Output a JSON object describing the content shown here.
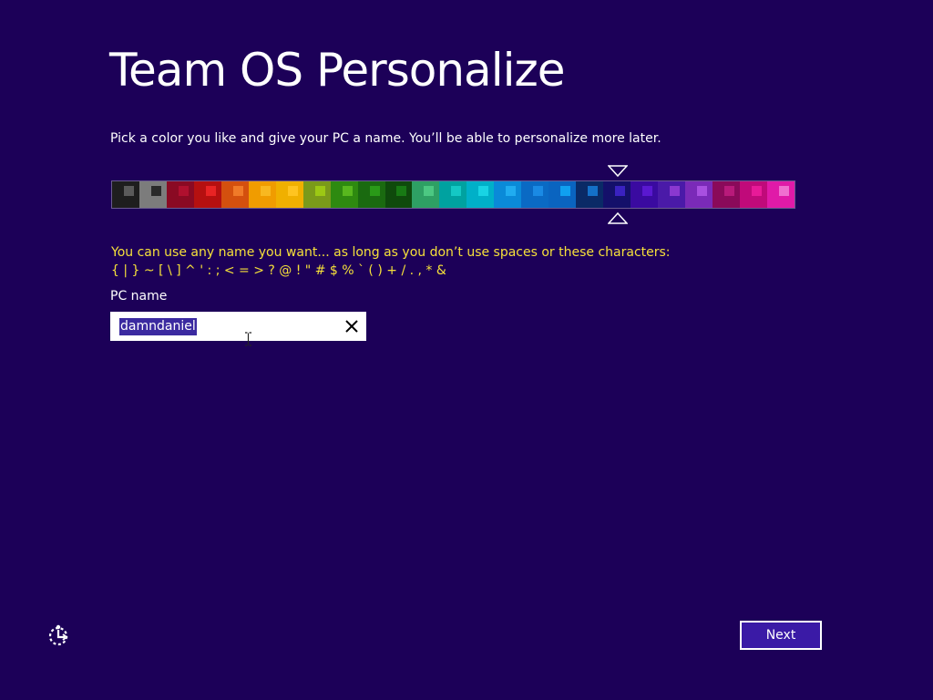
{
  "page": {
    "title": "Team OS Personalize",
    "subtitle": "Pick a color you like and give your PC a name. You’ll be able to personalize more later.",
    "background": "#1c0058"
  },
  "color_picker": {
    "selected_index": 18,
    "swatches": [
      {
        "bg": "#1e1e1e",
        "accent": "#5a5a5a"
      },
      {
        "bg": "#7c7c7c",
        "accent": "#2a2a2a"
      },
      {
        "bg": "#8a0a23",
        "accent": "#b0102e"
      },
      {
        "bg": "#b51010",
        "accent": "#e82424"
      },
      {
        "bg": "#d4500e",
        "accent": "#f07a28"
      },
      {
        "bg": "#f09c00",
        "accent": "#f8b820"
      },
      {
        "bg": "#f0b000",
        "accent": "#ffc420"
      },
      {
        "bg": "#7a9a1a",
        "accent": "#9cc814"
      },
      {
        "bg": "#2e8a10",
        "accent": "#58b81e"
      },
      {
        "bg": "#1a6a10",
        "accent": "#2a9a18"
      },
      {
        "bg": "#0f4a0c",
        "accent": "#187a14"
      },
      {
        "bg": "#2ea064",
        "accent": "#4cc882"
      },
      {
        "bg": "#00a2a0",
        "accent": "#14c8c4"
      },
      {
        "bg": "#00b0c8",
        "accent": "#18d4e4"
      },
      {
        "bg": "#0a8ad8",
        "accent": "#20acf0"
      },
      {
        "bg": "#0a6ac4",
        "accent": "#1a8ae4"
      },
      {
        "bg": "#0a64c0",
        "accent": "#10a0f0"
      },
      {
        "bg": "#0a2a66",
        "accent": "#1470c8"
      },
      {
        "bg": "#14106a",
        "accent": "#3a22c0"
      },
      {
        "bg": "#3a0aa0",
        "accent": "#5a18d0"
      },
      {
        "bg": "#4a1aa8",
        "accent": "#8a38d0"
      },
      {
        "bg": "#7a2ab8",
        "accent": "#a850e0"
      },
      {
        "bg": "#8a0a5a",
        "accent": "#b81a7a"
      },
      {
        "bg": "#c00a7a",
        "accent": "#e81a98"
      },
      {
        "bg": "#e01aa8",
        "accent": "#f070d0"
      }
    ]
  },
  "naming": {
    "rules_line1": "You can use any name you want... as long as you don’t use spaces or these characters:",
    "rules_line2": "{ | } ~ [ \\ ] ^ ' : ; < = > ? @ ! \" # $ % ` ( ) + / . , * &",
    "label": "PC name",
    "value": "damndaniel"
  },
  "footer": {
    "next_label": "Next"
  },
  "icons": {
    "clear": "close-icon",
    "ease_of_access": "ease-of-access-icon",
    "cursor": "text-cursor-icon"
  },
  "colors": {
    "warning_text": "#f6e03a",
    "next_button": "#3a1aa6",
    "selection": "#3b2aa0"
  }
}
